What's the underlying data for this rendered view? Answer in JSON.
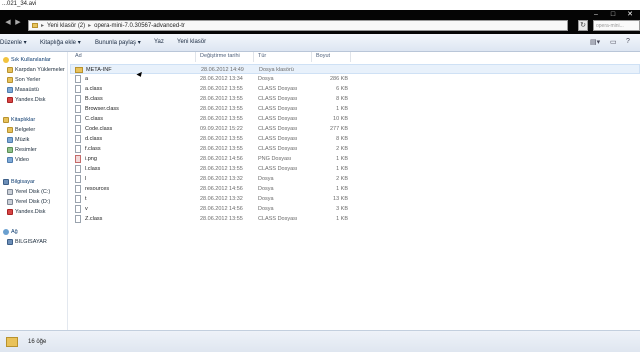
{
  "window": {
    "title_fragment": "...021_34.avi",
    "minimize": "–",
    "maximize": "□",
    "close": "✕"
  },
  "address": {
    "parts": [
      "Yeni klasör (2)",
      "opera-mini-7.0.30567-advanced-tr"
    ],
    "separator": "▸",
    "search_placeholder": "opera-mini..."
  },
  "toolbar": {
    "organize": "Düzenle ▾",
    "include_library": "Kitaplığa ekle ▾",
    "share": "Bununla paylaş ▾",
    "burn": "Yaz",
    "new_folder": "Yeni klasör"
  },
  "sidebar": {
    "favorites_header": "Sık Kullanılanlar",
    "favorites": [
      "Karpdan Yüklemeler",
      "Son Yerler",
      "Masaüstü",
      "Yandex.Disk"
    ],
    "libraries_header": "Kitaplıklar",
    "libraries": [
      "Belgeler",
      "Müzik",
      "Resimler",
      "Video"
    ],
    "computer_header": "Bilgisayar",
    "computer": [
      "Yerel Disk (C:)",
      "Yerel Disk (D:)",
      "Yandex.Disk"
    ],
    "network_header": "Ağ",
    "network": [
      "BILGISAYAR"
    ]
  },
  "columns": {
    "name": "Ad",
    "date": "Değiştirme tarihi",
    "type": "Tür",
    "size": "Boyut"
  },
  "files": [
    {
      "name": "META-INF",
      "date": "28.06.2012 14:49",
      "type": "Dosya klasörü",
      "size": "",
      "kind": "folder"
    },
    {
      "name": "a",
      "date": "28.06.2012 13:34",
      "type": "Dosya",
      "size": "286 KB",
      "kind": "file"
    },
    {
      "name": "a.class",
      "date": "28.06.2012 13:55",
      "type": "CLASS Dosyası",
      "size": "6 KB",
      "kind": "file"
    },
    {
      "name": "B.class",
      "date": "28.06.2012 13:55",
      "type": "CLASS Dosyası",
      "size": "8 KB",
      "kind": "file"
    },
    {
      "name": "Browser.class",
      "date": "28.06.2012 13:55",
      "type": "CLASS Dosyası",
      "size": "1 KB",
      "kind": "file"
    },
    {
      "name": "C.class",
      "date": "28.06.2012 13:55",
      "type": "CLASS Dosyası",
      "size": "10 KB",
      "kind": "file"
    },
    {
      "name": "Code.class",
      "date": "09.09.2012 15:22",
      "type": "CLASS Dosyası",
      "size": "277 KB",
      "kind": "file"
    },
    {
      "name": "d.class",
      "date": "28.06.2012 13:55",
      "type": "CLASS Dosyası",
      "size": "8 KB",
      "kind": "file"
    },
    {
      "name": "f.class",
      "date": "28.06.2012 13:55",
      "type": "CLASS Dosyası",
      "size": "2 KB",
      "kind": "file"
    },
    {
      "name": "i.png",
      "date": "28.06.2012 14:56",
      "type": "PNG Dosyası",
      "size": "1 KB",
      "kind": "png"
    },
    {
      "name": "l.class",
      "date": "28.06.2012 13:55",
      "type": "CLASS Dosyası",
      "size": "1 KB",
      "kind": "file"
    },
    {
      "name": "l",
      "date": "28.06.2012 13:32",
      "type": "Dosya",
      "size": "2 KB",
      "kind": "file"
    },
    {
      "name": "resources",
      "date": "28.06.2012 14:56",
      "type": "Dosya",
      "size": "1 KB",
      "kind": "file"
    },
    {
      "name": "t",
      "date": "28.06.2012 13:32",
      "type": "Dosya",
      "size": "13 KB",
      "kind": "file"
    },
    {
      "name": "v",
      "date": "28.06.2012 14:56",
      "type": "Dosya",
      "size": "3 KB",
      "kind": "file"
    },
    {
      "name": "Z.class",
      "date": "28.06.2012 13:55",
      "type": "CLASS Dosyası",
      "size": "1 KB",
      "kind": "file"
    }
  ],
  "status": {
    "count": "16 öğe"
  }
}
